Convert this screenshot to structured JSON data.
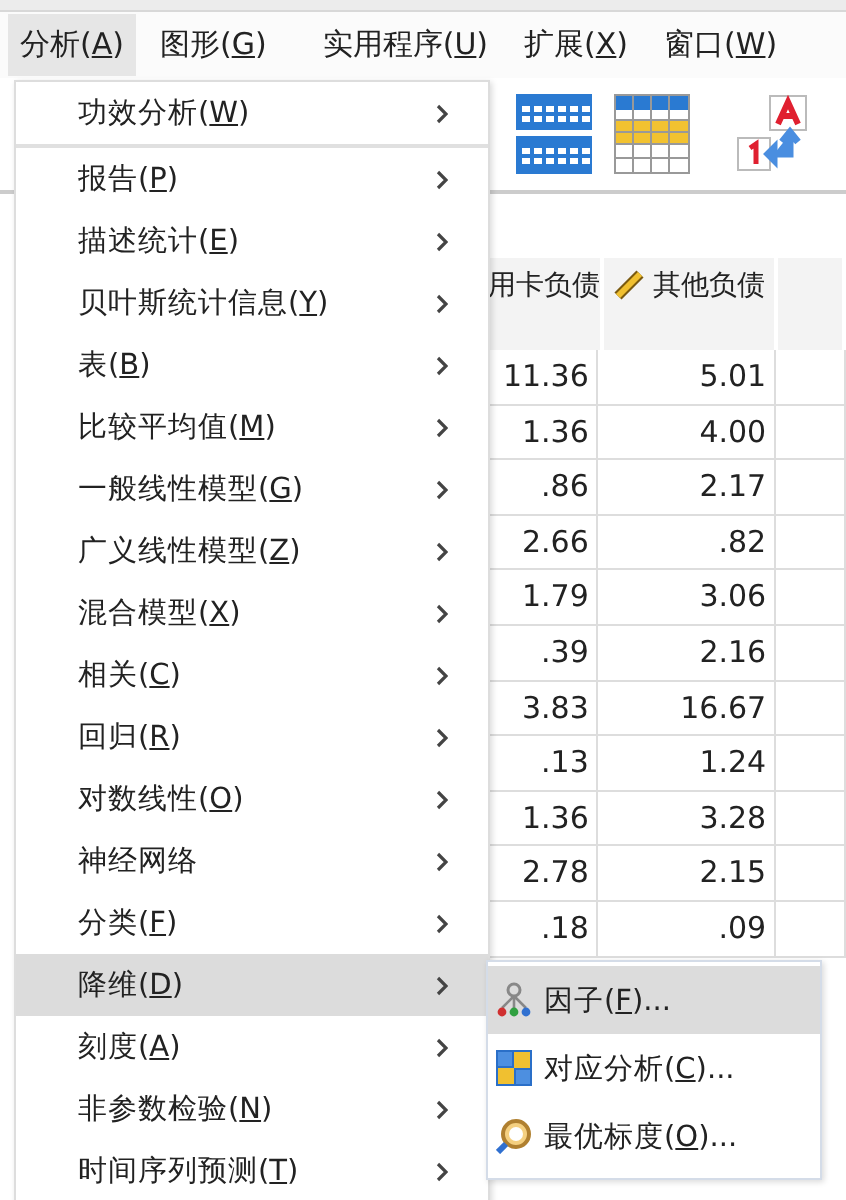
{
  "menubar": [
    {
      "label": "分析(A)",
      "selected": true
    },
    {
      "label": "图形(G)",
      "selected": false
    },
    {
      "label": "实用程序(U)",
      "selected": false
    },
    {
      "label": "扩展(X)",
      "selected": false
    },
    {
      "label": "窗口(W)",
      "selected": false
    }
  ],
  "table": {
    "columns": [
      {
        "label": "用卡负债",
        "kind": "plain"
      },
      {
        "label": "其他负债",
        "kind": "scale"
      }
    ],
    "rows": [
      [
        "11.36",
        "5.01"
      ],
      [
        "1.36",
        "4.00"
      ],
      [
        ".86",
        "2.17"
      ],
      [
        "2.66",
        ".82"
      ],
      [
        "1.79",
        "3.06"
      ],
      [
        ".39",
        "2.16"
      ],
      [
        "3.83",
        "16.67"
      ],
      [
        ".13",
        "1.24"
      ],
      [
        "1.36",
        "3.28"
      ],
      [
        "2.78",
        "2.15"
      ],
      [
        ".18",
        ".09"
      ]
    ]
  },
  "menu": {
    "items": [
      {
        "label": "功效分析(W)",
        "selected": false,
        "separator_after": true
      },
      {
        "label": "报告(P)",
        "selected": false,
        "separator_after": false
      },
      {
        "label": "描述统计(E)",
        "selected": false,
        "separator_after": false
      },
      {
        "label": "贝叶斯统计信息(Y)",
        "selected": false,
        "separator_after": false
      },
      {
        "label": "表(B)",
        "selected": false,
        "separator_after": false
      },
      {
        "label": "比较平均值(M)",
        "selected": false,
        "separator_after": false
      },
      {
        "label": "一般线性模型(G)",
        "selected": false,
        "separator_after": false
      },
      {
        "label": "广义线性模型(Z)",
        "selected": false,
        "separator_after": false
      },
      {
        "label": "混合模型(X)",
        "selected": false,
        "separator_after": false
      },
      {
        "label": "相关(C)",
        "selected": false,
        "separator_after": false
      },
      {
        "label": "回归(R)",
        "selected": false,
        "separator_after": false
      },
      {
        "label": "对数线性(O)",
        "selected": false,
        "separator_after": false
      },
      {
        "label": "神经网络",
        "selected": false,
        "separator_after": false
      },
      {
        "label": "分类(F)",
        "selected": false,
        "separator_after": false
      },
      {
        "label": "降维(D)",
        "selected": true,
        "separator_after": false
      },
      {
        "label": "刻度(A)",
        "selected": false,
        "separator_after": false
      },
      {
        "label": "非参数检验(N)",
        "selected": false,
        "separator_after": false
      },
      {
        "label": "时间序列预测(T)",
        "selected": false,
        "separator_after": false
      }
    ]
  },
  "submenu": {
    "items": [
      {
        "label": "因子(F)...",
        "kind": "factor",
        "selected": true
      },
      {
        "label": "对应分析(C)...",
        "kind": "correspondence",
        "selected": false
      },
      {
        "label": "最优标度(O)...",
        "kind": "optimal",
        "selected": false
      }
    ]
  }
}
